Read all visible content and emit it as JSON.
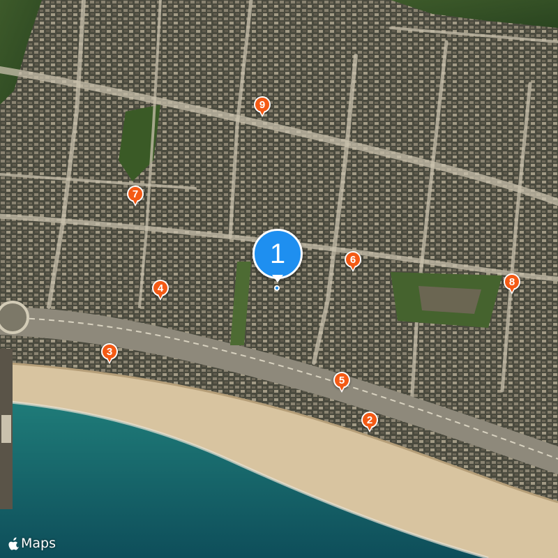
{
  "map": {
    "type": "satellite",
    "attribution": "Maps",
    "attribution_logo": "apple-logo-icon",
    "accent_color": "#1e8ff0",
    "marker_color": "#f45a15",
    "selected_marker": {
      "label": "1",
      "icon": "map-pin-selected-icon"
    },
    "markers": [
      {
        "label": "2",
        "icon": "map-pin-icon"
      },
      {
        "label": "3",
        "icon": "map-pin-icon"
      },
      {
        "label": "4",
        "icon": "map-pin-icon"
      },
      {
        "label": "5",
        "icon": "map-pin-icon"
      },
      {
        "label": "6",
        "icon": "map-pin-icon"
      },
      {
        "label": "7",
        "icon": "map-pin-icon"
      },
      {
        "label": "8",
        "icon": "map-pin-icon"
      },
      {
        "label": "9",
        "icon": "map-pin-icon"
      }
    ]
  }
}
